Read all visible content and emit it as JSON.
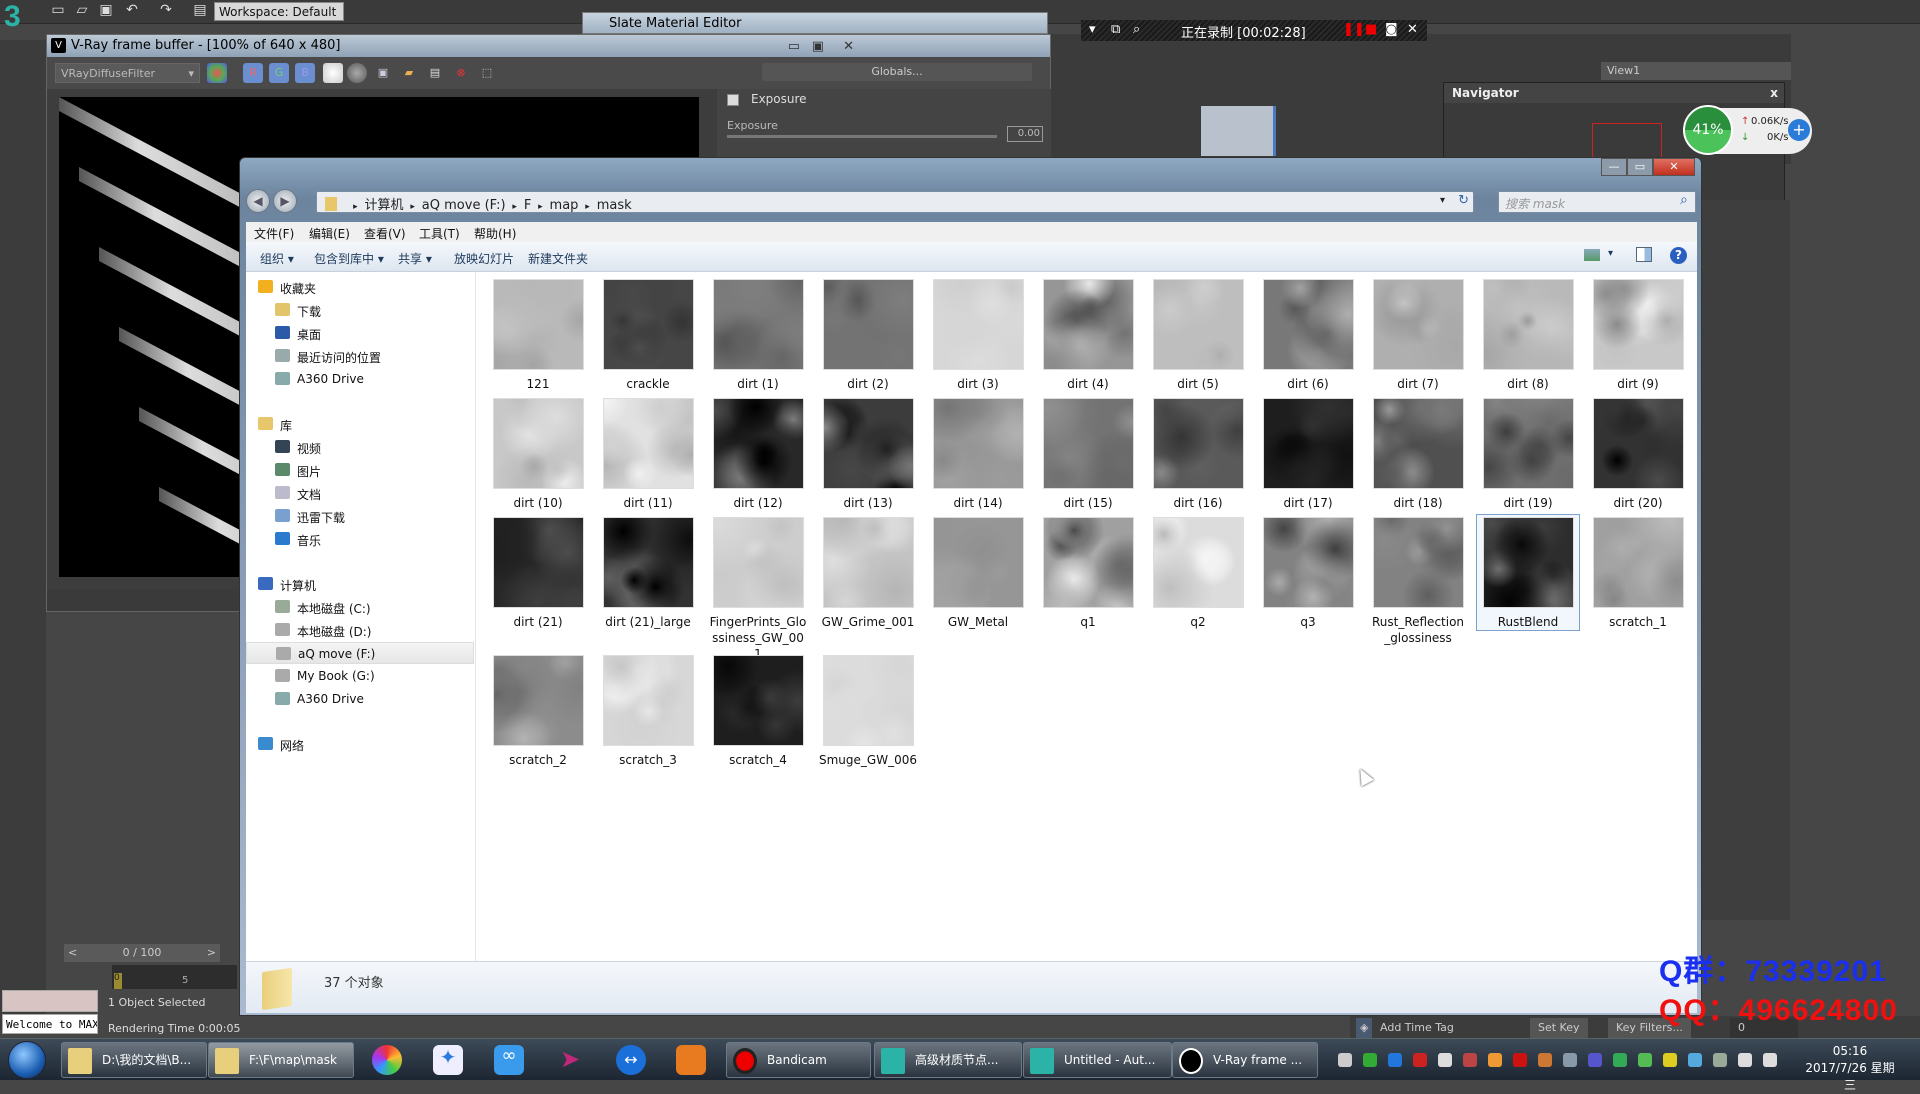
{
  "max": {
    "workspace": "Workspace: Default",
    "logo": "3",
    "timeslider": "0 / 100",
    "timeslider_prev": "<",
    "timeslider_next": ">",
    "track_ticks": [
      "0",
      "5"
    ],
    "status_selected": "1 Object Selected",
    "rendering_time": "Rendering Time  0:00:05",
    "welcome": "Welcome to MAXScript",
    "add_time_tag": "Add Time Tag",
    "set_key": "Set Key",
    "key_filters": "Key Filters...",
    "frame_field": "0",
    "view_select": "View1"
  },
  "vfb": {
    "title": "V-Ray frame buffer - [100% of 640 x 480]",
    "channel": "VRayDiffuseFilter",
    "buttons": [
      "R",
      "G",
      "B"
    ],
    "globals": "Globals...",
    "exposure_title": "Exposure",
    "exposure_label": "Exposure",
    "exposure_value": "0.00"
  },
  "slate": {
    "title": "Slate Material Editor"
  },
  "navigator": {
    "title": "Navigator"
  },
  "bandicam": {
    "status": "正在录制 [00:02:28]"
  },
  "netspeed": {
    "percent": "41%",
    "up": "0.06K/s",
    "down": "0K/s"
  },
  "explorer": {
    "breadcrumb": [
      "计算机",
      "aQ move (F:)",
      "F",
      "map",
      "mask"
    ],
    "search_placeholder": "搜索 mask",
    "menu": [
      "文件(F)",
      "编辑(E)",
      "查看(V)",
      "工具(T)",
      "帮助(H)"
    ],
    "commands": [
      "组织 ▾",
      "包含到库中 ▾",
      "共享 ▾",
      "放映幻灯片",
      "新建文件夹"
    ],
    "nav": [
      {
        "label": "收藏夹",
        "level": 0,
        "color": "#f2b01e"
      },
      {
        "label": "下载",
        "level": 1,
        "color": "#e2c56a"
      },
      {
        "label": "桌面",
        "level": 1,
        "color": "#2d5aa8"
      },
      {
        "label": "最近访问的位置",
        "level": 1,
        "color": "#9aa"
      },
      {
        "label": "A360 Drive",
        "level": 1,
        "color": "#8aa"
      },
      {
        "label": "",
        "level": -1
      },
      {
        "label": "库",
        "level": 0,
        "color": "#e8c76a"
      },
      {
        "label": "视频",
        "level": 1,
        "color": "#345"
      },
      {
        "label": "图片",
        "level": 1,
        "color": "#5a8a6a"
      },
      {
        "label": "文档",
        "level": 1,
        "color": "#bbc"
      },
      {
        "label": "迅雷下载",
        "level": 1,
        "color": "#7aa0d0"
      },
      {
        "label": "音乐",
        "level": 1,
        "color": "#2a7bd0"
      },
      {
        "label": "",
        "level": -1
      },
      {
        "label": "计算机",
        "level": 0,
        "color": "#3a6ac0"
      },
      {
        "label": "本地磁盘 (C:)",
        "level": 1,
        "color": "#9a9"
      },
      {
        "label": "本地磁盘 (D:)",
        "level": 1,
        "color": "#aaa"
      },
      {
        "label": "aQ move (F:)",
        "level": 1,
        "color": "#aaa",
        "selected": true
      },
      {
        "label": "My Book (G:)",
        "level": 1,
        "color": "#aaa"
      },
      {
        "label": "A360 Drive",
        "level": 1,
        "color": "#8aa"
      },
      {
        "label": "",
        "level": -1
      },
      {
        "label": "网络",
        "level": 0,
        "color": "#3a8ad0"
      }
    ],
    "files": [
      "121",
      "crackle",
      "dirt (1)",
      "dirt (2)",
      "dirt (3)",
      "dirt (4)",
      "dirt (5)",
      "dirt (6)",
      "dirt (7)",
      "dirt (8)",
      "dirt (9)",
      "dirt (10)",
      "dirt (11)",
      "dirt (12)",
      "dirt (13)",
      "dirt (14)",
      "dirt (15)",
      "dirt (16)",
      "dirt (17)",
      "dirt (18)",
      "dirt (19)",
      "dirt (20)",
      "dirt (21)",
      "dirt (21)_large",
      "FingerPrints_Glossiness_GW_001",
      "GW_Grime_001",
      "GW_Metal",
      "q1",
      "q2",
      "q3",
      "Rust_Reflection_glossiness",
      "RustBlend",
      "scratch_1",
      "scratch_2",
      "scratch_3",
      "scratch_4",
      "Smuge_GW_006"
    ],
    "selected_file": "RustBlend",
    "status": "37 个对象"
  },
  "watermark": {
    "qgroup": "Q群：73339201",
    "qq": "QQ：496624800"
  },
  "taskbar": {
    "items": [
      "D:\\我的文档\\B...",
      "F:\\F\\map\\mask",
      "Bandicam",
      "高级材质节点...",
      "Untitled - Aut...",
      "V-Ray frame ..."
    ],
    "time": "05:16",
    "date": "2017/7/26 星期三"
  }
}
